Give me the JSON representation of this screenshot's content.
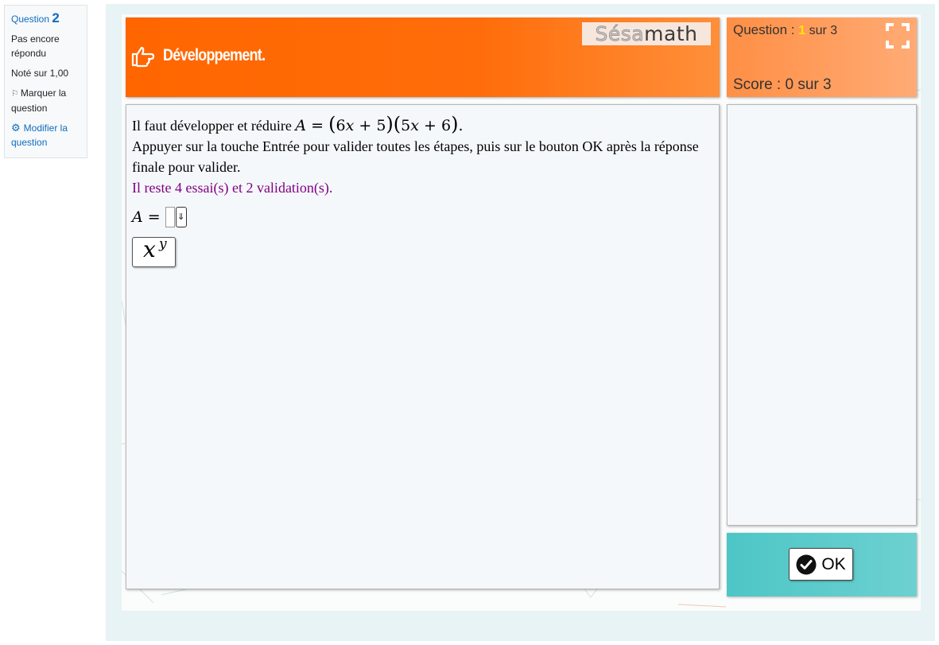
{
  "question_info": {
    "label": "Question",
    "number": "2",
    "state": "Pas encore répondu",
    "grade": "Noté sur 1,00",
    "flag_label": "Marquer la question",
    "edit_label": "Modifier la question"
  },
  "header": {
    "title": "Développement.",
    "logo_left": "Sésa",
    "logo_right": "math"
  },
  "score": {
    "question_prefix": "Question : ",
    "current": "1",
    "total_text": " sur 3",
    "score_text": "Score : 0 sur 3"
  },
  "statement": {
    "intro": "Il faut développer et réduire ",
    "expression": "A = (6x + 5)(5x + 6)",
    "instructions": "Appuyer sur la touche Entrée pour valider toutes les étapes, puis sur le bouton OK après la réponse finale pour valider.",
    "tries": "Il reste 4 essai(s) et 2 validation(s)."
  },
  "answer": {
    "label": "A =",
    "dropdown_symbol": "⇓",
    "power_button_base": "x",
    "power_button_exp": "y"
  },
  "ok_button": {
    "label": "OK"
  },
  "colors": {
    "header_orange": "#ff6600",
    "score_orange": "#ff9a55",
    "ok_panel": "#5ccbcb",
    "tries_purple": "#800080",
    "link_blue": "#0f6cbf"
  },
  "icons": [
    "hand-point-right-icon",
    "fullscreen-icon",
    "flag-icon",
    "gear-icon",
    "check-circle-icon"
  ]
}
